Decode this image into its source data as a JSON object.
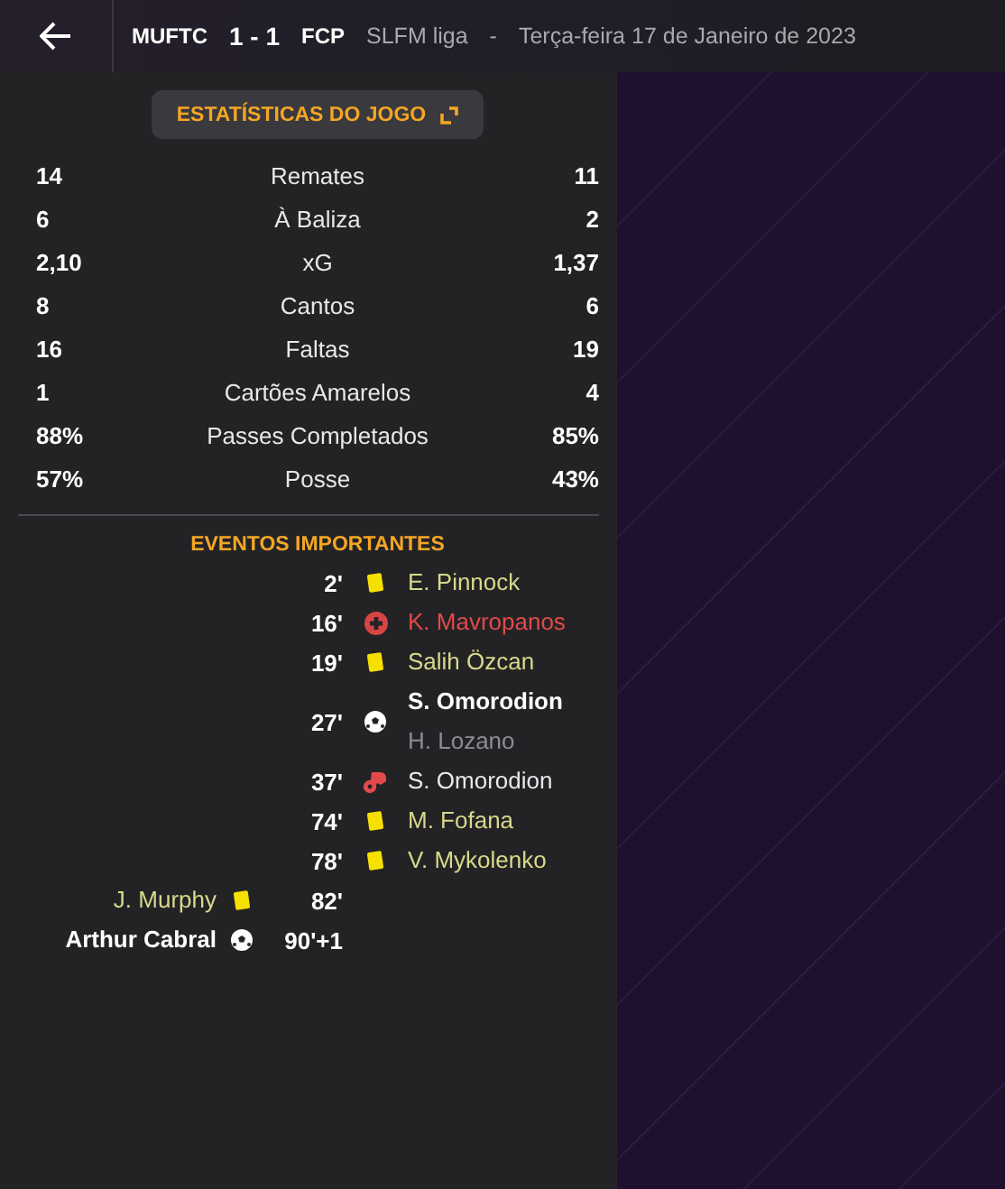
{
  "header": {
    "home": "MUFTC",
    "score": "1 - 1",
    "away": "FCP",
    "competition": "SLFM liga",
    "separator": "-",
    "date": "Terça-feira 17 de Janeiro de 2023"
  },
  "stats_button": {
    "label": "ESTATÍSTICAS DO JOGO"
  },
  "stats": [
    {
      "home": "14",
      "label": "Remates",
      "away": "11"
    },
    {
      "home": "6",
      "label": "À Baliza",
      "away": "2"
    },
    {
      "home": "2,10",
      "label": "xG",
      "away": "1,37"
    },
    {
      "home": "8",
      "label": "Cantos",
      "away": "6"
    },
    {
      "home": "16",
      "label": "Faltas",
      "away": "19"
    },
    {
      "home": "1",
      "label": "Cartões Amarelos",
      "away": "4"
    },
    {
      "home": "88%",
      "label": "Passes Completados",
      "away": "85%"
    },
    {
      "home": "57%",
      "label": "Posse",
      "away": "43%"
    }
  ],
  "events_title": "EVENTOS IMPORTANTES",
  "events": [
    {
      "minute": "2'",
      "kind": "yellow",
      "away_players": [
        {
          "name": "E. Pinnock",
          "kind": "booked"
        }
      ]
    },
    {
      "minute": "16'",
      "kind": "injury",
      "away_players": [
        {
          "name": "K. Mavropanos",
          "kind": "injured"
        }
      ]
    },
    {
      "minute": "19'",
      "kind": "yellow",
      "away_players": [
        {
          "name": "Salih Özcan",
          "kind": "booked"
        }
      ]
    },
    {
      "minute": "27'",
      "kind": "goal",
      "away_players": [
        {
          "name": "S. Omorodion",
          "kind": "scorer"
        },
        {
          "name": "H. Lozano",
          "kind": "assist"
        }
      ]
    },
    {
      "minute": "37'",
      "kind": "miss",
      "away_players": [
        {
          "name": "S. Omorodion",
          "kind": "normal"
        }
      ]
    },
    {
      "minute": "74'",
      "kind": "yellow",
      "away_players": [
        {
          "name": "M. Fofana",
          "kind": "booked"
        }
      ]
    },
    {
      "minute": "78'",
      "kind": "yellow",
      "away_players": [
        {
          "name": "V. Mykolenko",
          "kind": "booked"
        }
      ]
    },
    {
      "minute": "82'",
      "kind": "yellow",
      "home_players": [
        {
          "name": "J. Murphy",
          "kind": "booked"
        }
      ]
    },
    {
      "minute": "90'+1",
      "kind": "goal",
      "home_players": [
        {
          "name": "Arthur Cabral",
          "kind": "scorer"
        }
      ]
    }
  ]
}
